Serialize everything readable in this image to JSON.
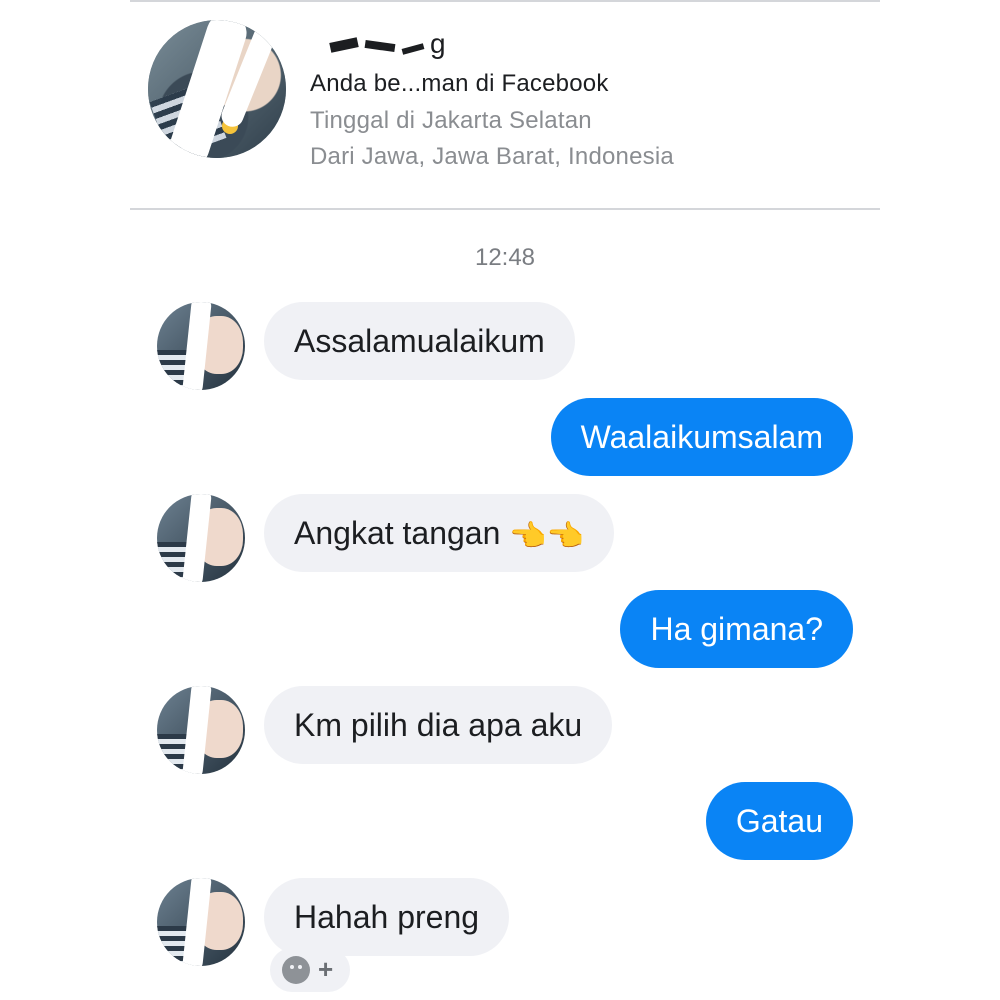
{
  "profile": {
    "name_visible_fragment": "g",
    "friends_line": "Anda be...man di Facebook",
    "lives_in": "Tinggal di Jakarta Selatan",
    "from": "Dari Jawa, Jawa Barat, Indonesia"
  },
  "conversation": {
    "timestamp": "12:48",
    "messages": [
      {
        "sender": "them",
        "text": "Assalamualaikum"
      },
      {
        "sender": "me",
        "text": "Waalaikumsalam"
      },
      {
        "sender": "them",
        "text": "Angkat tangan",
        "emoji": "👈👈"
      },
      {
        "sender": "me",
        "text": "Ha gimana?"
      },
      {
        "sender": "them",
        "text": "Km pilih dia apa aku"
      },
      {
        "sender": "me",
        "text": "Gatau"
      },
      {
        "sender": "them",
        "text": "Hahah preng"
      }
    ]
  },
  "reaction_button": {
    "icon": "smiley-icon",
    "plus": "+"
  },
  "colors": {
    "outgoing_bubble": "#0a84f5",
    "incoming_bubble": "#f0f1f5",
    "secondary_text": "#8a8d91"
  }
}
